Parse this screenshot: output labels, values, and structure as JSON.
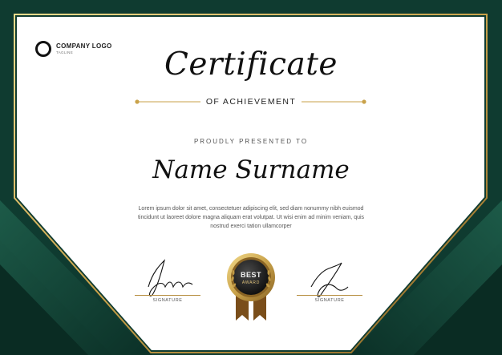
{
  "logo": {
    "name": "COMPANY LOGO",
    "tagline": "TAGLINE"
  },
  "certificate": {
    "title": "Certificate",
    "subtitle": "OF ACHIEVEMENT",
    "presented_label": "PROUDLY PRESENTED TO",
    "recipient": "Name Surname",
    "body": "Lorem ipsum dolor sit amet, consectetuer adipiscing elit, sed diam nonummy nibh euismod tincidunt ut laoreet dolore magna aliquam erat volutpat. Ut wisi enim ad minim veniam, quis nostrud exerci tation ullamcorper"
  },
  "signatures": [
    {
      "label": "SIGNATURE"
    },
    {
      "label": "SIGNATURE"
    }
  ],
  "badge": {
    "line1": "BEST",
    "line2": "AWARD"
  },
  "colors": {
    "dark_green": "#0f3b30",
    "mid_green": "#1d5c49",
    "gold": "#c9a24a",
    "paper": "#ffffff"
  }
}
